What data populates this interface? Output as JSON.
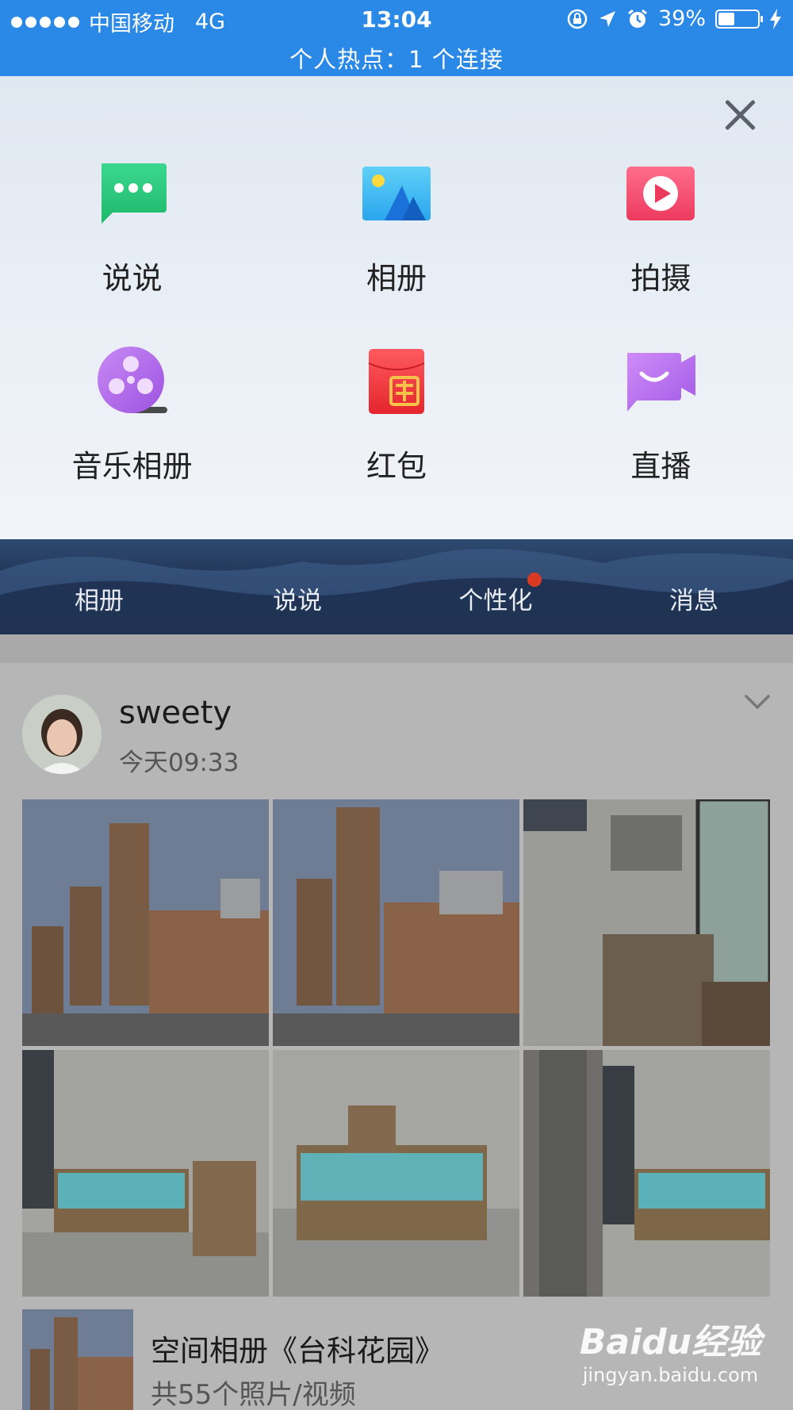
{
  "status_bar": {
    "carrier": "中国移动",
    "network": "4G",
    "time": "13:04",
    "battery": "39%",
    "battery_level": 0.39,
    "hotspot": "个人热点：1 个连接"
  },
  "publish_menu": {
    "items": [
      {
        "label": "说说",
        "icon": "chat-bubble-icon",
        "color": "#26c77c"
      },
      {
        "label": "相册",
        "icon": "photo-album-icon",
        "color": "#3ab7f0"
      },
      {
        "label": "拍摄",
        "icon": "video-record-icon",
        "color": "#f24a6f"
      },
      {
        "label": "音乐相册",
        "icon": "music-album-icon",
        "color": "#b06be8"
      },
      {
        "label": "红包",
        "icon": "red-packet-icon",
        "color": "#f0393f"
      },
      {
        "label": "直播",
        "icon": "live-stream-icon",
        "color": "#b06be8"
      }
    ]
  },
  "profile_tabs": [
    {
      "label": "相册"
    },
    {
      "label": "说说"
    },
    {
      "label": "个性化",
      "badge": true
    },
    {
      "label": "消息"
    }
  ],
  "feed": {
    "post": {
      "username": "sweety",
      "time": "今天09:33",
      "photo_count": 6
    },
    "album": {
      "title": "空间相册《台科花园》",
      "subtitle": "共55个照片/视频"
    }
  },
  "watermark": {
    "brand": "Baidu经验",
    "url": "jingyan.baidu.com"
  }
}
